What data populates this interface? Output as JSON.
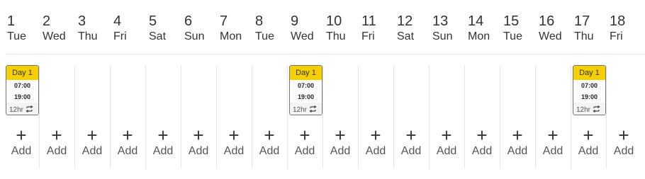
{
  "days": [
    {
      "num": "1",
      "name": "Tue"
    },
    {
      "num": "2",
      "name": "Wed"
    },
    {
      "num": "3",
      "name": "Thu"
    },
    {
      "num": "4",
      "name": "Fri"
    },
    {
      "num": "5",
      "name": "Sat"
    },
    {
      "num": "6",
      "name": "Sun"
    },
    {
      "num": "7",
      "name": "Mon"
    },
    {
      "num": "8",
      "name": "Tue"
    },
    {
      "num": "9",
      "name": "Wed"
    },
    {
      "num": "10",
      "name": "Thu"
    },
    {
      "num": "11",
      "name": "Fri"
    },
    {
      "num": "12",
      "name": "Sat"
    },
    {
      "num": "13",
      "name": "Sun"
    },
    {
      "num": "14",
      "name": "Mon"
    },
    {
      "num": "15",
      "name": "Tue"
    },
    {
      "num": "16",
      "name": "Wed"
    },
    {
      "num": "17",
      "name": "Thu"
    },
    {
      "num": "18",
      "name": "Fri"
    }
  ],
  "shifts": [
    {
      "day_index": 0,
      "title": "Day 1",
      "start": "07:00",
      "end": "19:00",
      "duration": "12hr",
      "icon": "repeat-icon"
    },
    {
      "day_index": 8,
      "title": "Day 1",
      "start": "07:00",
      "end": "19:00",
      "duration": "12hr",
      "icon": "repeat-icon"
    },
    {
      "day_index": 16,
      "title": "Day 1",
      "start": "07:00",
      "end": "19:00",
      "duration": "12hr",
      "icon": "repeat-icon"
    }
  ],
  "add": {
    "symbol": "+",
    "label": "Add"
  },
  "colors": {
    "shift_header": "#f5cf00",
    "shift_border": "#777777"
  }
}
